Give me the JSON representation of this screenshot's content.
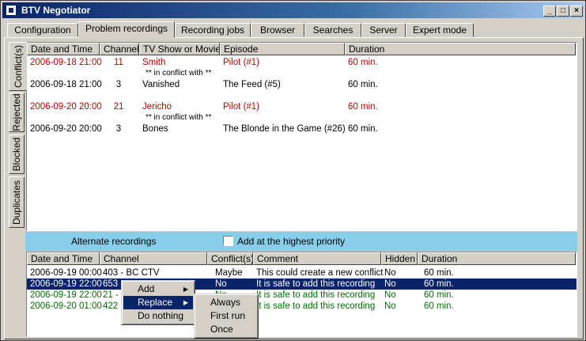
{
  "window": {
    "title": "BTV Negotiator",
    "min": "_",
    "max": "□",
    "close": "×"
  },
  "tabs": [
    "Configuration",
    "Problem recordings",
    "Recording jobs",
    "Browser",
    "Searches",
    "Server",
    "Expert mode"
  ],
  "active_tab": "Problem recordings",
  "vtabs": [
    "Conflict(s)",
    "Rejected",
    "Blocked",
    "Duplicates"
  ],
  "top_list": {
    "columns": [
      "Date and Time",
      "Channel",
      "TV Show or Movie",
      "Episode",
      "Duration"
    ],
    "rows": [
      {
        "date": "2006-09-18 21:00",
        "channel": "11",
        "show": "Smith",
        "episode": "Pilot (#1)",
        "duration": "60 min.",
        "style": "red"
      },
      {
        "date": "",
        "channel": "",
        "show": "** in conflict with **",
        "episode": "",
        "duration": "",
        "style": "note"
      },
      {
        "date": "2006-09-18 21:00",
        "channel": "3",
        "show": "Vanished",
        "episode": "The Feed (#5)",
        "duration": "60 min.",
        "style": "normal"
      },
      {
        "date": "",
        "channel": "",
        "show": "",
        "episode": "",
        "duration": "",
        "style": "blank"
      },
      {
        "date": "2006-09-20 20:00",
        "channel": "21",
        "show": "Jericho",
        "episode": "Pilot (#1)",
        "duration": "60 min.",
        "style": "red"
      },
      {
        "date": "",
        "channel": "",
        "show": "** in conflict with **",
        "episode": "",
        "duration": "",
        "style": "note"
      },
      {
        "date": "2006-09-20 20:00",
        "channel": "3",
        "show": "Bones",
        "episode": "The Blonde in the Game (#26)",
        "duration": "60 min.",
        "style": "normal"
      }
    ]
  },
  "alternate": {
    "label": "Alternate recordings",
    "checkbox_label": "Add at the highest priority"
  },
  "bottom_list": {
    "columns": [
      "Date and Time",
      "Channel",
      "Conflict(s)",
      "Comment",
      "Hidden",
      "Duration"
    ],
    "rows": [
      {
        "date": "2006-09-19 00:00",
        "channel": "403 - BC CTV",
        "conflict": "Maybe",
        "comment": "This could create a new conflict",
        "hidden": "No",
        "duration": "60 min.",
        "style": "normal"
      },
      {
        "date": "2006-09-19 22:00",
        "channel": "653",
        "conflict": "No",
        "comment": "It is safe to add this recording",
        "hidden": "No",
        "duration": "60 min.",
        "style": "selected"
      },
      {
        "date": "2006-09-19 22:00",
        "channel": "21 -",
        "conflict": "No",
        "comment": "It is safe to add this recording",
        "hidden": "No",
        "duration": "60 min.",
        "style": "green"
      },
      {
        "date": "2006-09-20 01:00",
        "channel": "422",
        "conflict": "No",
        "comment": "It is safe to add this recording",
        "hidden": "No",
        "duration": "60 min.",
        "style": "green"
      }
    ]
  },
  "context_menu": {
    "items": [
      "Add",
      "Replace",
      "Do nothing"
    ],
    "highlighted": "Replace"
  },
  "submenu": {
    "items": [
      "Always",
      "First run",
      "Once"
    ]
  }
}
